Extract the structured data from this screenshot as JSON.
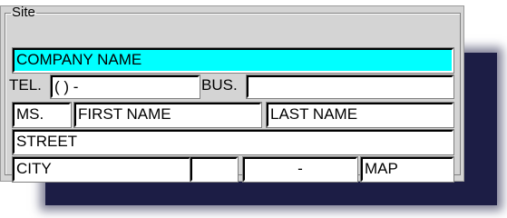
{
  "group": {
    "title": "Site"
  },
  "fields": {
    "company": "COMPANY NAME",
    "tel_label": "TEL.",
    "tel_value": "(   )   -",
    "bus_label": "BUS.",
    "bus_value": "",
    "title": "MS.",
    "first_name": "FIRST NAME",
    "last_name": "LAST NAME",
    "street": "STREET",
    "city": "CITY",
    "state": "",
    "zip": "-",
    "map": "MAP"
  },
  "colors": {
    "highlight": "#00ffff",
    "shadow": "#1c1d45"
  }
}
